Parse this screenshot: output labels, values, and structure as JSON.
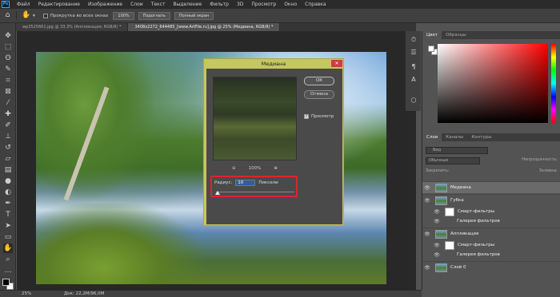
{
  "menu": {
    "app_icon": "Ps",
    "items": [
      "Файл",
      "Редактирование",
      "Изображение",
      "Слои",
      "Текст",
      "Выделение",
      "Фильтр",
      "3D",
      "Просмотр",
      "Окно",
      "Справка"
    ]
  },
  "options_bar": {
    "tool_icon": "hand-icon",
    "scroll_all_label": "Прокрутка во всех окнах",
    "zoom_100": "100%",
    "fit_button": "Подогнать",
    "fullscreen_button": "Полный экран"
  },
  "tabs": [
    {
      "label": "wp3525661.jpg @ 33,3% (Аппликация, RGB/8) *",
      "active": false
    },
    {
      "label": "3408x2272_644485_[www.ArtFile.ru].jpg @ 25% (Медиана, RGB/8) *",
      "active": true
    }
  ],
  "tools": [
    "move-icon",
    "marquee-icon",
    "lasso-icon",
    "quick-select-icon",
    "crop-icon",
    "frame-icon",
    "eyedropper-icon",
    "healing-icon",
    "brush-icon",
    "stamp-icon",
    "history-brush-icon",
    "eraser-icon",
    "gradient-icon",
    "blur-icon",
    "dodge-icon",
    "pen-icon",
    "type-icon",
    "path-select-icon",
    "shape-icon",
    "hand-icon",
    "zoom-icon",
    "more-icon"
  ],
  "dialog": {
    "title": "Медиана",
    "close": "✕",
    "ok_button": "ОК",
    "cancel_button": "Отмена",
    "preview_label": "Просмотр",
    "preview_checked": true,
    "zoom_level": "100%",
    "radius_label": "Радиус:",
    "radius_value": "10",
    "radius_unit": "Пиксели",
    "highlight_color": "#e0232e"
  },
  "color_panel": {
    "tabs": [
      "Цвет",
      "Образцы"
    ],
    "hue_color": "#ff0000"
  },
  "layers_panel": {
    "tabs": [
      "Слои",
      "Каналы",
      "Контуры"
    ],
    "search_placeholder": "Вид",
    "blend_mode": "Обычные",
    "opacity_label": "Непрозрачность:",
    "lock_label": "Закрепить:",
    "fill_label": "Заливка:",
    "layers": [
      {
        "name": "Медиана",
        "selected": true,
        "smart_filters": []
      },
      {
        "name": "Губка",
        "selected": false,
        "smart_filters": [
          "Смарт-фильтры",
          "Галерея фильтров"
        ]
      },
      {
        "name": "Аппликация",
        "selected": false,
        "smart_filters": [
          "Смарт-фильтры",
          "Галерея фильтров"
        ]
      },
      {
        "name": "Слой 0",
        "selected": false,
        "smart_filters": []
      }
    ]
  },
  "status": {
    "zoom": "25%",
    "doc_size": "Док: 22,2M/96,0M"
  }
}
